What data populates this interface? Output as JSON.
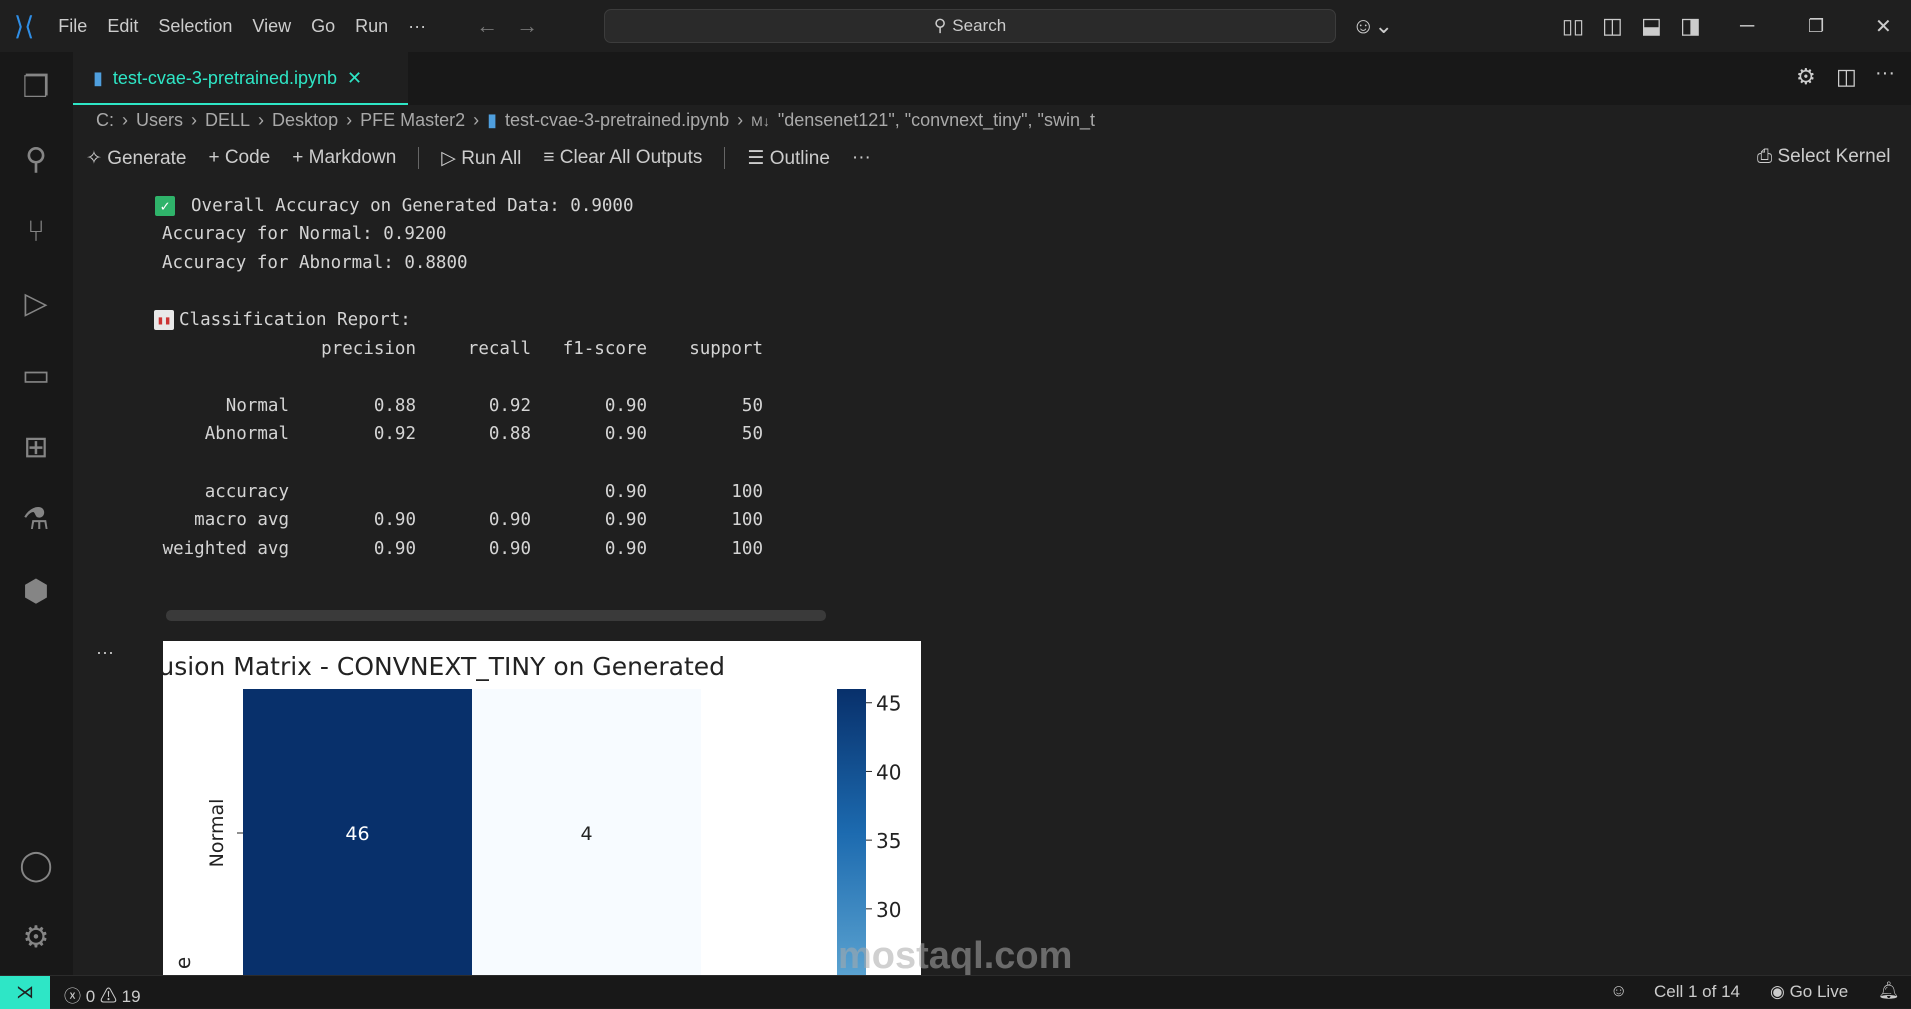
{
  "menu": [
    "File",
    "Edit",
    "Selection",
    "View",
    "Go",
    "Run",
    "···"
  ],
  "search": {
    "label": "Search"
  },
  "tab": {
    "label": "test-cvae-3-pretrained.ipynb"
  },
  "breadcrumb": [
    "C:",
    "Users",
    "DELL",
    "Desktop",
    "PFE Master2",
    "test-cvae-3-pretrained.ipynb",
    "\"densenet121\", \"convnext_tiny\", \"swin_t"
  ],
  "breadcrumb_md": "M↓",
  "toolbar": {
    "generate": "Generate",
    "code": "Code",
    "markdown": "Markdown",
    "run_all": "Run All",
    "clear": "Clear All Outputs",
    "outline": "Outline",
    "more": "···",
    "kernel": "Select Kernel"
  },
  "output": {
    "overall": "Overall Accuracy on Generated Data: 0.9000",
    "normal": "Accuracy for Normal: 0.9200",
    "abnormal": "Accuracy for Abnormal: 0.8800",
    "report_title": "Classification Report:",
    "headers": [
      "precision",
      "recall",
      "f1-score",
      "support"
    ],
    "rows": [
      [
        "Normal",
        "0.88",
        "0.92",
        "0.90",
        "50"
      ],
      [
        "Abnormal",
        "0.92",
        "0.88",
        "0.90",
        "50"
      ],
      [
        "accuracy",
        "",
        "",
        "0.90",
        "100"
      ],
      [
        "macro avg",
        "0.90",
        "0.90",
        "0.90",
        "100"
      ],
      [
        "weighted avg",
        "0.90",
        "0.90",
        "0.90",
        "100"
      ]
    ],
    "cell_more": "···"
  },
  "chart_data": {
    "type": "heatmap",
    "title": "Confusion Matrix - CONVNEXT_TINY on Generated",
    "ylabel_partial": "e",
    "row_labels": [
      "Normal"
    ],
    "values": [
      [
        46,
        4
      ]
    ],
    "colorbar_ticks": [
      "45",
      "40",
      "35",
      "30"
    ],
    "colorbar_range": [
      4,
      46
    ],
    "cmap": "Blues"
  },
  "watermark": "mostaql.com",
  "status": {
    "errors": "0",
    "warnings": "19",
    "cell": "Cell 1 of 14",
    "golive": "Go Live"
  },
  "colors": {
    "accent": "#2ee6c6",
    "bg": "#1f1f1f",
    "dark_cell": "#08306b",
    "light_cell": "#f7fbff"
  }
}
